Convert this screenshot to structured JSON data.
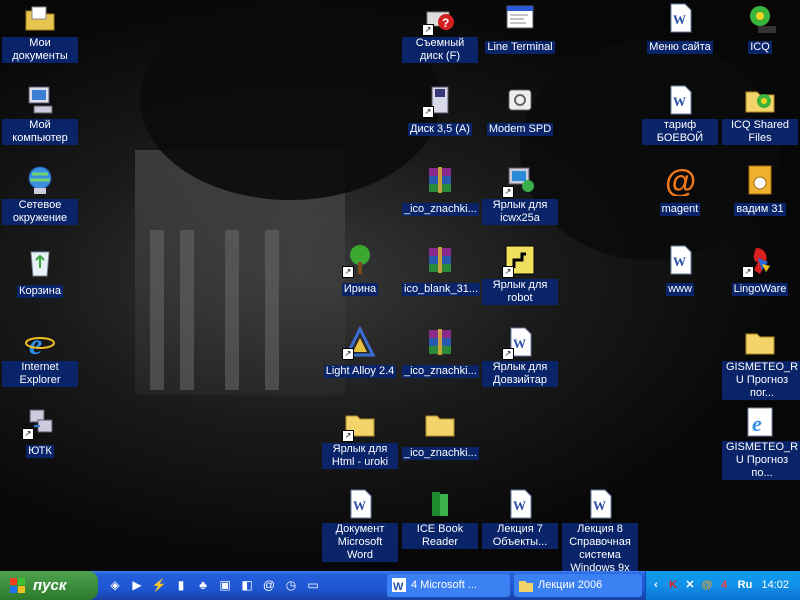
{
  "desktop": {
    "icons": [
      {
        "id": "my-documents",
        "label": "Мои документы",
        "icon": "folder-documents-icon"
      },
      {
        "id": "my-computer",
        "label": "Мой компьютер",
        "icon": "computer-icon"
      },
      {
        "id": "network",
        "label": "Сетевое окружение",
        "icon": "network-icon"
      },
      {
        "id": "recycle-bin",
        "label": "Корзина",
        "icon": "recycle-bin-icon"
      },
      {
        "id": "internet-explorer",
        "label": "Internet Explorer",
        "icon": "internet-explorer-icon"
      },
      {
        "id": "utk",
        "label": "ЮТК",
        "icon": "network-connection-icon"
      },
      {
        "id": "irina",
        "label": "Ирина",
        "icon": "tree-icon"
      },
      {
        "id": "light-alloy",
        "label": "Light Alloy 2.4",
        "icon": "light-alloy-icon"
      },
      {
        "id": "html-uroki",
        "label": "Ярлык для Html - uroki",
        "icon": "folder-icon"
      },
      {
        "id": "word-document",
        "label": "Документ Microsoft Word",
        "icon": "word-document-icon"
      },
      {
        "id": "removable-disk",
        "label": "Съемный диск (F)",
        "icon": "removable-disk-icon"
      },
      {
        "id": "floppy",
        "label": "Диск 3,5 (A)",
        "icon": "floppy-icon"
      },
      {
        "id": "ico-znachki-1",
        "label": "_ico_znachki...",
        "icon": "winrar-archive-icon"
      },
      {
        "id": "ico-blank",
        "label": "ico_blank_31...",
        "icon": "winrar-archive-icon"
      },
      {
        "id": "ico-znachki-2",
        "label": "_ico_znachki...",
        "icon": "winrar-archive-icon"
      },
      {
        "id": "ico-znachki-3",
        "label": "_ico_znachki...",
        "icon": "folder-icon"
      },
      {
        "id": "ice-book-reader",
        "label": "ICE Book Reader",
        "icon": "book-reader-icon"
      },
      {
        "id": "line-terminal",
        "label": "Line Terminal",
        "icon": "terminal-window-icon"
      },
      {
        "id": "modem-spd",
        "label": "Modem SPD",
        "icon": "modem-icon"
      },
      {
        "id": "icwx25a",
        "label": "Ярлык для icwx25a",
        "icon": "program-icon"
      },
      {
        "id": "robot",
        "label": "Ярлык для robot",
        "icon": "robot-icon"
      },
      {
        "id": "dovzhitar",
        "label": "Ярлык для Довзийтар",
        "icon": "word-document-icon"
      },
      {
        "id": "lecture-7",
        "label": "Лекция 7 Объекты...",
        "icon": "word-document-icon"
      },
      {
        "id": "lecture-8",
        "label": "Лекция 8 Справочная система Windows 9x",
        "icon": "word-document-icon"
      },
      {
        "id": "menu-saita",
        "label": "Меню сайта",
        "icon": "word-document-icon"
      },
      {
        "id": "tarif-boevoy",
        "label": "тариф БОЕВОЙ",
        "icon": "word-document-icon"
      },
      {
        "id": "magent",
        "label": "magent",
        "icon": "mail-agent-icon"
      },
      {
        "id": "www",
        "label": "www",
        "icon": "word-document-icon"
      },
      {
        "id": "icq",
        "label": "ICQ",
        "icon": "icq-flower-icon"
      },
      {
        "id": "icq-shared",
        "label": "ICQ Shared Files",
        "icon": "icq-folder-icon"
      },
      {
        "id": "vadim-31",
        "label": "вадим 31",
        "icon": "jpeg-image-icon"
      },
      {
        "id": "lingoware",
        "label": "LingoWare",
        "icon": "parrot-icon"
      },
      {
        "id": "gismeteo-1",
        "label": "GISMETEO_RU Прогноз пог...",
        "icon": "folder-icon"
      },
      {
        "id": "gismeteo-2",
        "label": "GISMETEO_RU Прогноз по...",
        "icon": "internet-explorer-icon"
      }
    ]
  },
  "taskbar": {
    "start_label": "пуск",
    "quick_launch": [
      "desktop-show-icon",
      "media-player-icon",
      "winamp-icon",
      "usb-icon",
      "tree-icon",
      "floppy-icon",
      "disk-icon",
      "mail-agent-icon",
      "clock-icon",
      "folder-icon"
    ],
    "tasks": [
      {
        "label": "4 Microsoft ...",
        "icon": "word-icon"
      },
      {
        "label": "Лекции 2006",
        "icon": "folder-icon"
      }
    ],
    "tray": {
      "chevron": "chevron-left-icon",
      "icons": [
        "antivirus-icon",
        "network-icon",
        "mail-agent-icon",
        "agent-icon"
      ],
      "lang": "Ru",
      "clock": "14:02"
    }
  }
}
